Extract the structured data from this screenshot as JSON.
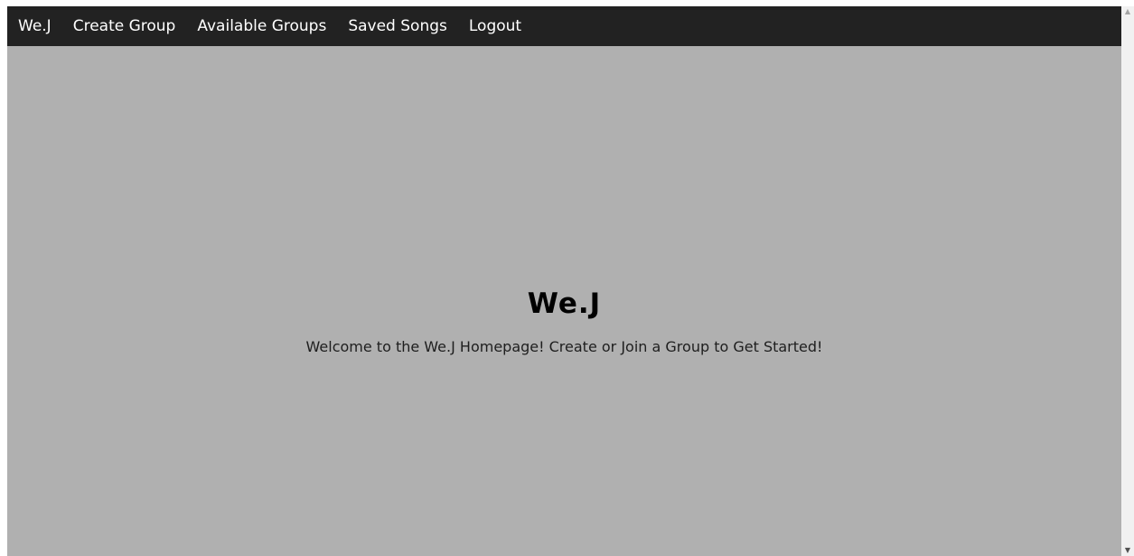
{
  "navbar": {
    "brand": "We.J",
    "items": [
      {
        "label": "Create Group"
      },
      {
        "label": "Available Groups"
      },
      {
        "label": "Saved Songs"
      },
      {
        "label": "Logout"
      }
    ]
  },
  "hero": {
    "title": "We.J",
    "text": "Welcome to the We.J Homepage! Create or Join a Group to Get Started!"
  },
  "scrollbar": {
    "up_icon": "▲",
    "down_icon": "▼"
  },
  "colors": {
    "navbar_bg": "#222222",
    "page_bg": "#b0b0b0",
    "nav_text": "#ffffff"
  }
}
